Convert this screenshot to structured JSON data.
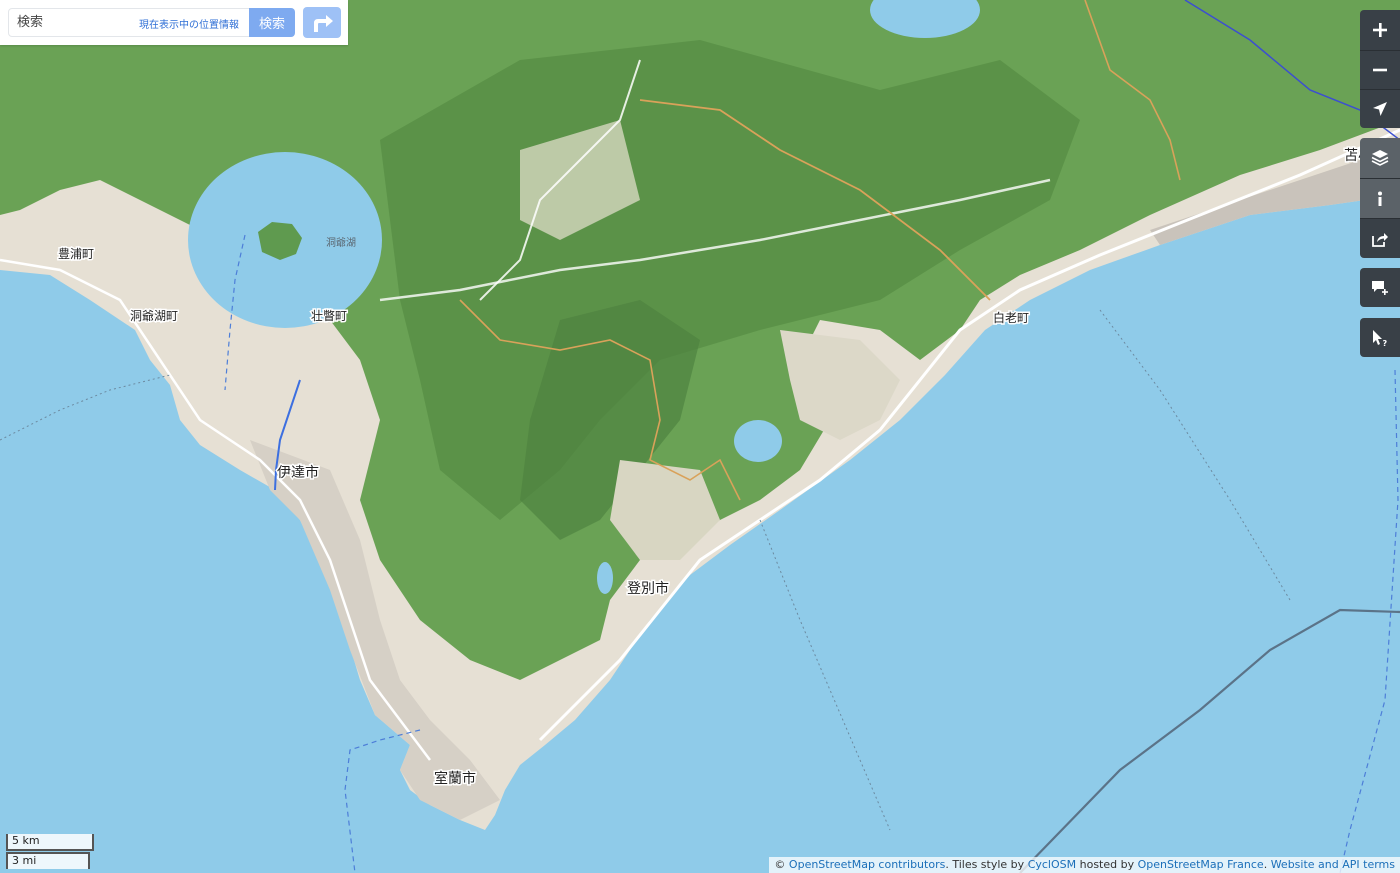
{
  "search": {
    "placeholder": "検索",
    "where_is_this": "現在表示中の位置情報",
    "button_label": "検索"
  },
  "controls": [
    {
      "name": "zoom-in",
      "icon": "plus-icon"
    },
    {
      "name": "zoom-out",
      "icon": "minus-icon"
    },
    {
      "name": "show-my-location",
      "icon": "location-arrow-icon"
    },
    {
      "name": "layers",
      "icon": "layers-icon"
    },
    {
      "name": "map-key",
      "icon": "info-icon"
    },
    {
      "name": "share",
      "icon": "share-icon"
    },
    {
      "name": "add-note",
      "icon": "note-plus-icon"
    },
    {
      "name": "query-features",
      "icon": "cursor-question-icon"
    }
  ],
  "map": {
    "labels": {
      "toyoura": "豊浦町",
      "toyako_lake": "洞爺湖",
      "toyako_town": "洞爺湖町",
      "sobetsu": "壮瞥町",
      "date": "伊達市",
      "noboribetsu": "登別市",
      "muroran": "室蘭市",
      "shiraoi": "白老町",
      "tomakomai": "苫小牧市"
    },
    "colors": {
      "sea": "#8fcbe9",
      "forest": "#5f9a4f",
      "forest_light": "#7db066",
      "urban": "#e2dcd2",
      "road": "#ffffff",
      "track": "#d9a25a",
      "ferry": "#4d7ed8",
      "boundary": "#5b7388"
    }
  },
  "scale": {
    "metric": "5 km",
    "imperial": "3 mi"
  },
  "attribution": {
    "prefix": "© ",
    "osm": "OpenStreetMap contributors",
    "mid1": ". Tiles style by ",
    "cyclosm": "CyclOSM",
    "mid2": " hosted by ",
    "osmfr": "OpenStreetMap France",
    "mid3": ". ",
    "terms": "Website and API terms"
  }
}
